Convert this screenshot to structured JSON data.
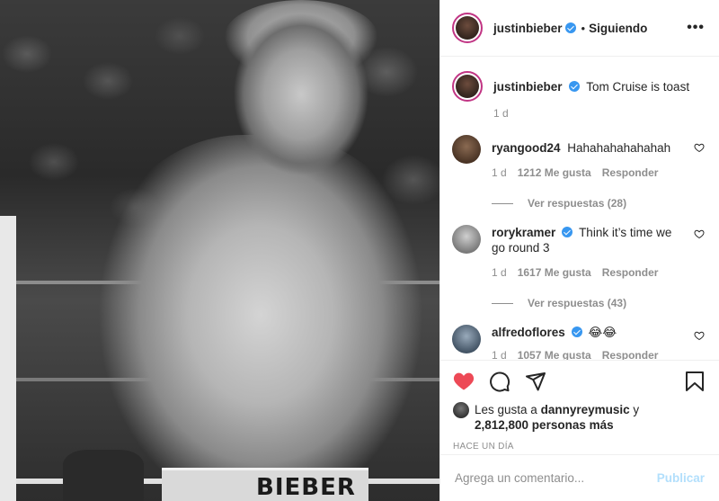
{
  "photo": {
    "waistband_text": "BIEBER"
  },
  "header": {
    "username": "justinbieber",
    "separator": "•",
    "follow_status": "Siguiendo",
    "more_label": "•••"
  },
  "caption": {
    "username": "justinbieber",
    "text": "Tom Cruise is toast",
    "time": "1 d"
  },
  "comments": [
    {
      "username": "ryangood24",
      "verified": false,
      "text": "Hahahahahahahah",
      "time": "1 d",
      "likes": "1212 Me gusta",
      "reply_label": "Responder",
      "view_replies": "Ver respuestas (28)"
    },
    {
      "username": "rorykramer",
      "verified": true,
      "text": "Think it’s time we go round 3",
      "time": "1 d",
      "likes": "1617 Me gusta",
      "reply_label": "Responder",
      "view_replies": "Ver respuestas (43)"
    },
    {
      "username": "alfredoflores",
      "verified": true,
      "text": "😂😂",
      "time": "1 d",
      "likes": "1057 Me gusta",
      "reply_label": "Responder"
    }
  ],
  "likes": {
    "prefix": "Les gusta a",
    "user": "dannyreymusic",
    "conj": "y",
    "others": "2,812,800 personas más"
  },
  "time_ago": "HACE UN DÍA",
  "add_comment": {
    "placeholder": "Agrega un comentario...",
    "publish_label": "Publicar"
  },
  "colors": {
    "heart_liked": "#ed4956",
    "verified": "#3897f0",
    "publish_disabled": "#b2dffc",
    "story_ring": "#c13584"
  },
  "icons": {
    "like": "heart-icon",
    "comment": "comment-icon",
    "share": "paper-plane-icon",
    "save": "bookmark-icon",
    "more": "ellipsis-icon"
  }
}
